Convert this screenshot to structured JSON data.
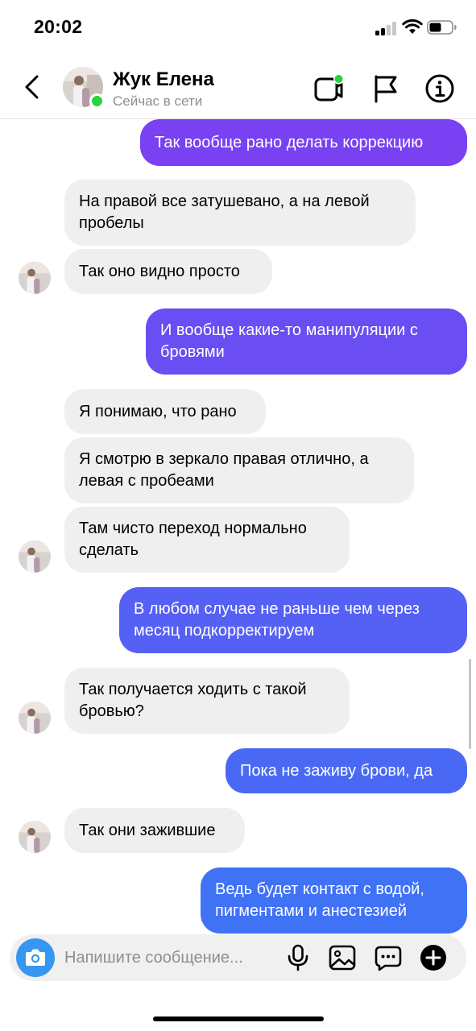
{
  "status_bar": {
    "time": "20:02"
  },
  "header": {
    "contact_name": "Жук Елена",
    "contact_status": "Сейчас в сети",
    "icons": [
      "back-icon",
      "video-call-icon",
      "flag-icon",
      "info-icon"
    ]
  },
  "messages": [
    {
      "dir": "out",
      "text": "Так вообще рано делать коррекцию"
    },
    {
      "dir": "in",
      "text": "На правой все затушевано, а на левой пробелы"
    },
    {
      "dir": "in",
      "text": "Так оно видно просто"
    },
    {
      "dir": "out",
      "text": "И вообще какие-то манипуляции с бровями"
    },
    {
      "dir": "in",
      "text": "Я понимаю, что рано"
    },
    {
      "dir": "in",
      "text": "Я смотрю в зеркало правая отлично, а левая с пробеами"
    },
    {
      "dir": "in",
      "text": "Там чисто переход нормально сделать"
    },
    {
      "dir": "out",
      "text": "В любом случае не раньше чем через месяц подкорректируем"
    },
    {
      "dir": "in",
      "text": "Так получается ходить с такой бровью?"
    },
    {
      "dir": "out",
      "text": "Пока не заживу брови, да"
    },
    {
      "dir": "in",
      "text": "Так они зажившие"
    },
    {
      "dir": "out",
      "text": "Ведь будет контакт с водой, пигментами и анестезией"
    }
  ],
  "composer": {
    "placeholder": "Напишите сообщение...",
    "icons": [
      "camera-icon",
      "microphone-icon",
      "gallery-icon",
      "sticker-icon",
      "plus-icon"
    ]
  },
  "colors": {
    "bubble_in": "#efefef",
    "gradient_purple": "#7b3ff2",
    "gradient_blue": "#3d74f6",
    "camera_button": "#3797f0",
    "online": "#2ad33b"
  }
}
